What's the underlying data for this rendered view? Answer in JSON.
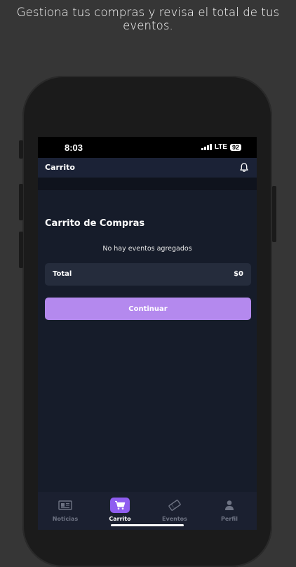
{
  "caption": "Gestiona tus compras y revisa el total de tus eventos.",
  "status_bar": {
    "time": "8:03",
    "network": "LTE",
    "battery": "92"
  },
  "header": {
    "title": "Carrito",
    "bell_icon": "bell-icon"
  },
  "cart": {
    "title": "Carrito de Compras",
    "empty_message": "No hay eventos agregados",
    "total_label": "Total",
    "total_value": "$0",
    "continue_label": "Continuar"
  },
  "colors": {
    "accent": "#b489ee",
    "active_tab": "#8f5df0",
    "background": "#161c2a"
  },
  "tabs": [
    {
      "label": "Noticias",
      "icon": "newspaper-icon",
      "active": false
    },
    {
      "label": "Carrito",
      "icon": "cart-icon",
      "active": true
    },
    {
      "label": "Eventos",
      "icon": "ticket-icon",
      "active": false
    },
    {
      "label": "Perfil",
      "icon": "person-icon",
      "active": false
    }
  ]
}
